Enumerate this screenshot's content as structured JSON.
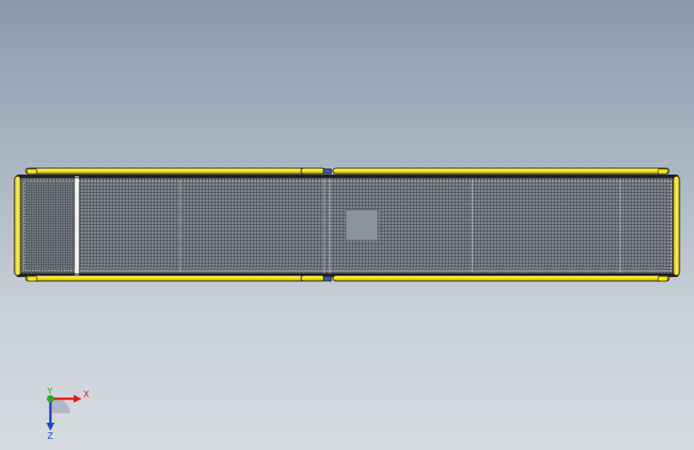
{
  "viewport": {
    "background_top": "#8a99aa",
    "background_bottom": "#d6dbe0"
  },
  "model": {
    "frame_color": "#f2e51a",
    "frame_outline": "#1a1a1a",
    "mesh_color": "#2a2a2a",
    "panel_fill": "#7b828a",
    "window_fill": "#8c939b",
    "connector_color": "#3c5a9c"
  },
  "triad": {
    "x_label": "X",
    "y_label": "Y",
    "z_label": "Z",
    "x_color": "#e02020",
    "y_color": "#20b020",
    "z_color": "#2040d0"
  }
}
